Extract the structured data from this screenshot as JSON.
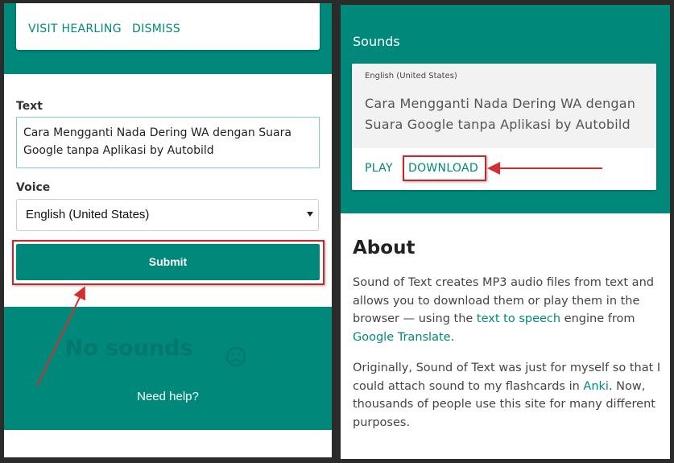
{
  "left": {
    "notice": {
      "visit_label": "VISIT HEARLING",
      "dismiss_label": "DISMISS"
    },
    "form": {
      "text_label": "Text",
      "text_value": "Cara Mengganti Nada Dering WA dengan Suara Google tanpa Aplikasi by Autobild",
      "voice_label": "Voice",
      "voice_value": "English (United States)",
      "submit_label": "Submit"
    },
    "no_sounds": "No sounds",
    "help_link": "Need help?"
  },
  "right": {
    "sounds_title": "Sounds",
    "sound": {
      "language": "English (United States)",
      "text": "Cara Mengganti Nada Dering WA dengan Suara Google tanpa Aplikasi by Autobild",
      "play_label": "PLAY",
      "download_label": "DOWNLOAD"
    },
    "about": {
      "heading": "About",
      "p1_a": "Sound of Text creates MP3 audio files from text and allows you to download them or play them in the browser — using the ",
      "p1_link1": "text to speech",
      "p1_b": " engine from ",
      "p1_link2": "Google Translate",
      "p1_c": ".",
      "p2_a": "Originally, Sound of Text was just for myself so that I could attach sound to my flashcards in ",
      "p2_link": "Anki",
      "p2_b": ". Now, thousands of people use this site for many different purposes."
    }
  },
  "colors": {
    "teal": "#00897b",
    "highlight": "#c62828",
    "link": "#00897b"
  }
}
